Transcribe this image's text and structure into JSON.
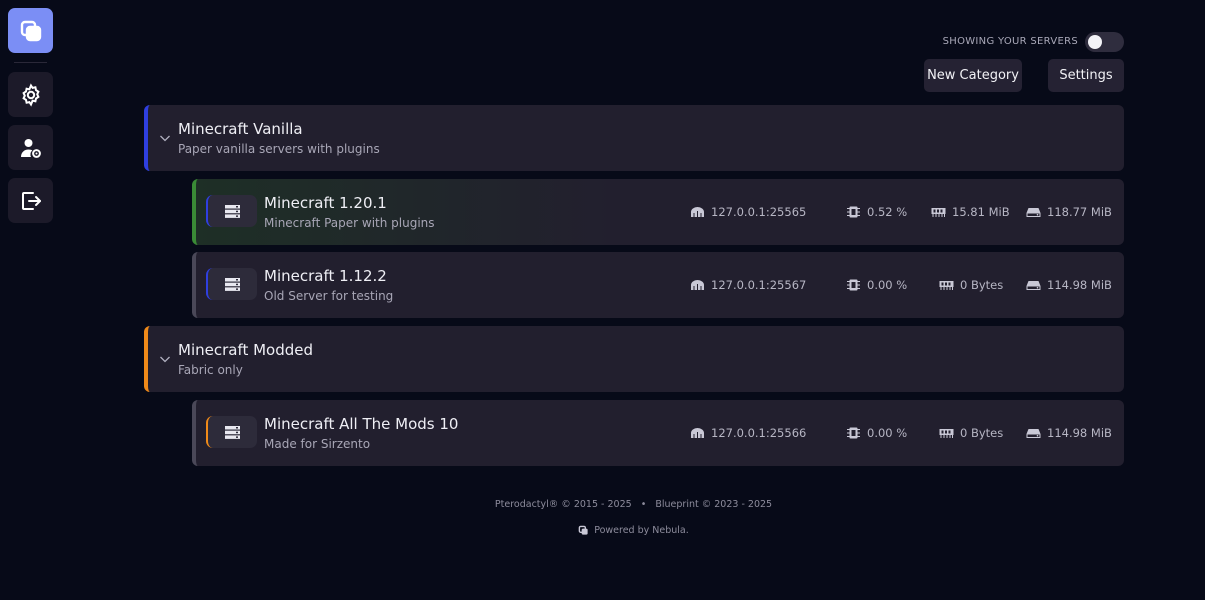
{
  "sidebar": {
    "items": [
      {
        "name": "logo-icon"
      },
      {
        "name": "gear-icon"
      },
      {
        "name": "user-settings-icon"
      },
      {
        "name": "logout-icon"
      }
    ]
  },
  "toolbar": {
    "toggle_label": "SHOWING YOUR SERVERS",
    "new_category_label": "New Category",
    "settings_label": "Settings"
  },
  "categories": [
    {
      "title": "Minecraft Vanilla",
      "description": "Paper vanilla servers with plugins",
      "accent": "#2f3fe0",
      "servers": [
        {
          "title": "Minecraft 1.20.1",
          "description": "Minecraft Paper with plugins",
          "address": "127.0.0.1:25565",
          "cpu": "0.52 %",
          "memory": "15.81 MiB",
          "disk": "118.77 MiB",
          "status_color": "#3a8b36"
        },
        {
          "title": "Minecraft 1.12.2",
          "description": "Old Server for testing",
          "address": "127.0.0.1:25567",
          "cpu": "0.00 %",
          "memory": "0 Bytes",
          "disk": "114.98 MiB",
          "status_color": "#4a4858"
        }
      ]
    },
    {
      "title": "Minecraft Modded",
      "description": "Fabric only",
      "accent": "#f08a19",
      "servers": [
        {
          "title": "Minecraft All The Mods 10",
          "description": "Made for Sirzento",
          "address": "127.0.0.1:25566",
          "cpu": "0.00 %",
          "memory": "0 Bytes",
          "disk": "114.98 MiB",
          "status_color": "#4a4858"
        }
      ]
    }
  ],
  "footer": {
    "copyright": "Pterodactyl® © 2015 - 2025   •   Blueprint © 2023 - 2025",
    "powered": "Powered by Nebula."
  }
}
